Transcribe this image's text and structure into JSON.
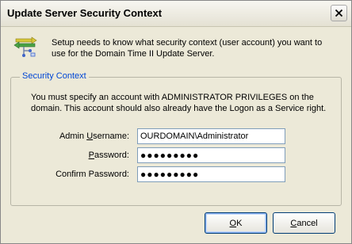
{
  "window": {
    "title": "Update Server Security Context"
  },
  "intro": {
    "text": "Setup needs to know what security context (user account) you want to use for the Domain Time II Update Server."
  },
  "group": {
    "legend": "Security Context",
    "text": "You must specify an account with ADMINISTRATOR PRIVILEGES on the domain. This account should also already have the Logon as a Service right."
  },
  "form": {
    "username_label_pre": "Admin ",
    "username_label_u": "U",
    "username_label_post": "sername:",
    "username_value": "OURDOMAIN\\Administrator",
    "password_label_u": "P",
    "password_label_post": "assword:",
    "password_value": "●●●●●●●●●",
    "confirm_label": "Confirm Password:",
    "confirm_value": "●●●●●●●●●"
  },
  "buttons": {
    "ok_u": "O",
    "ok_post": "K",
    "cancel_u": "C",
    "cancel_post": "ancel"
  }
}
